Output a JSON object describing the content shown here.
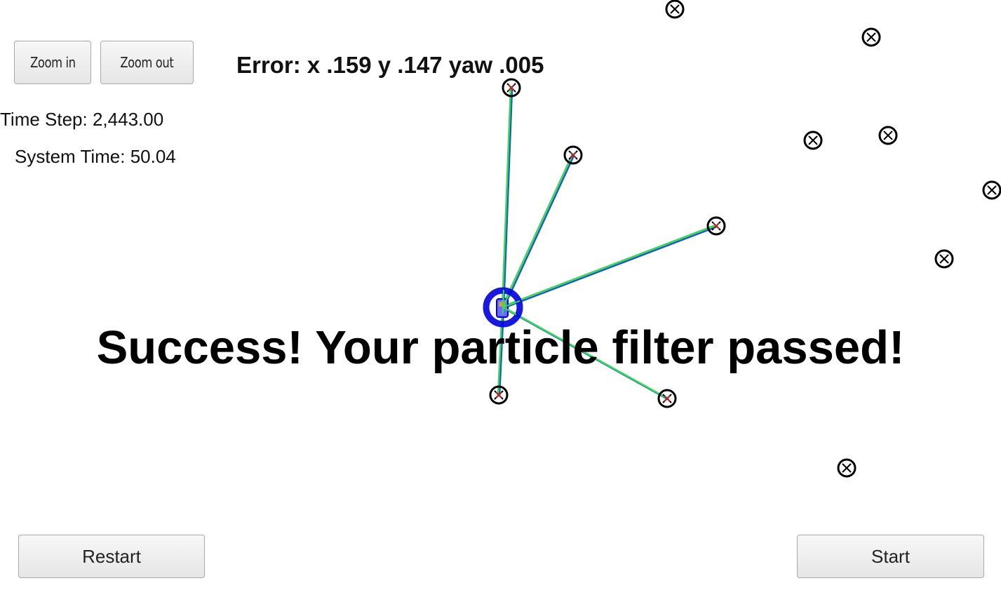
{
  "controls": {
    "zoom_in_label": "Zoom in",
    "zoom_out_label": "Zoom out",
    "restart_label": "Restart",
    "start_label": "Start"
  },
  "status": {
    "time_step": "Time Step: 2,443.00",
    "system_time": "System Time: 50.04",
    "error": "Error: x .159 y .147 yaw .005",
    "message": "Success! Your particle filter passed!"
  },
  "colors": {
    "landmark": "#000000",
    "vehicle": "#0000dd",
    "observation_line": "#33dd55",
    "prediction_line": "#2255cc",
    "marker_cross": "#dd2222"
  },
  "icons": {
    "landmark": "circle-x-icon",
    "vehicle": "car-icon"
  }
}
